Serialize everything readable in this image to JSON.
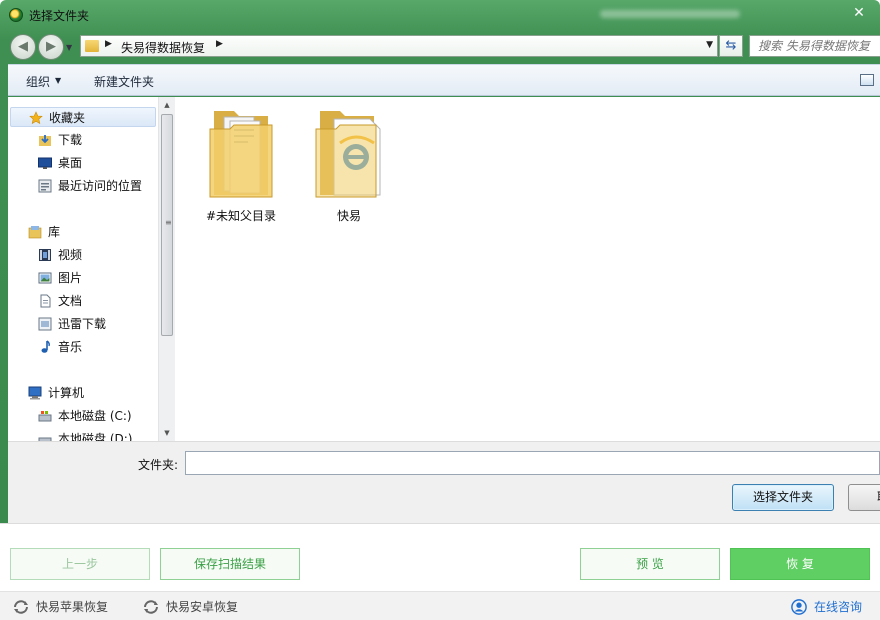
{
  "titlebar": {
    "title": "选择文件夹",
    "close": "✕"
  },
  "nav": {
    "back": "◀",
    "forward": "▶",
    "dropdown": "▼"
  },
  "addressbar": {
    "separator": "▶",
    "crumb": "失易得数据恢复",
    "dropdown": "▼"
  },
  "refresh": {
    "icon": "⇆"
  },
  "search": {
    "placeholder": "搜索 失易得数据恢复"
  },
  "toolbar": {
    "organize": "组织",
    "organize_dd": "▼",
    "new_folder": "新建文件夹"
  },
  "navpane": {
    "items": [
      {
        "label": "收藏夹",
        "icon": "star-icon"
      },
      {
        "label": "下载",
        "icon": "download-folder-icon"
      },
      {
        "label": "桌面",
        "icon": "desktop-icon"
      },
      {
        "label": "最近访问的位置",
        "icon": "recent-places-icon"
      },
      {
        "label": "库",
        "icon": "library-icon"
      },
      {
        "label": "视频",
        "icon": "video-library-icon"
      },
      {
        "label": "图片",
        "icon": "pictures-library-icon"
      },
      {
        "label": "文档",
        "icon": "documents-library-icon"
      },
      {
        "label": "迅雷下载",
        "icon": "xunlei-download-icon"
      },
      {
        "label": "音乐",
        "icon": "music-library-icon"
      },
      {
        "label": "计算机",
        "icon": "computer-icon"
      },
      {
        "label": "本地磁盘 (C:)",
        "icon": "local-disk-icon"
      },
      {
        "label": "本地磁盘 (D:)",
        "icon": "local-disk-icon"
      }
    ]
  },
  "scrollbar": {
    "up": "▲",
    "down": "▼",
    "grip": "≡"
  },
  "files": [
    {
      "label": "#未知父目录",
      "icon": "folder-with-documents-icon"
    },
    {
      "label": "快易",
      "icon": "folder-with-ie-icon"
    }
  ],
  "bottom": {
    "folder_label": "文件夹:",
    "folder_value": "",
    "select_button": "选择文件夹",
    "cancel_button": "取消"
  },
  "app": {
    "prev": "上一步",
    "save_scan": "保存扫描结果",
    "preview": "预 览",
    "recover": "恢 复",
    "footer_apple": "快易苹果恢复",
    "footer_android": "快易安卓恢复",
    "footer_consult": "在线咨询"
  },
  "colors": {
    "frame_green": "#3f8f52",
    "app_green": "#5fcf63",
    "link_blue": "#1f6fd1",
    "dialog_button_blue": "#bfe0f5"
  }
}
